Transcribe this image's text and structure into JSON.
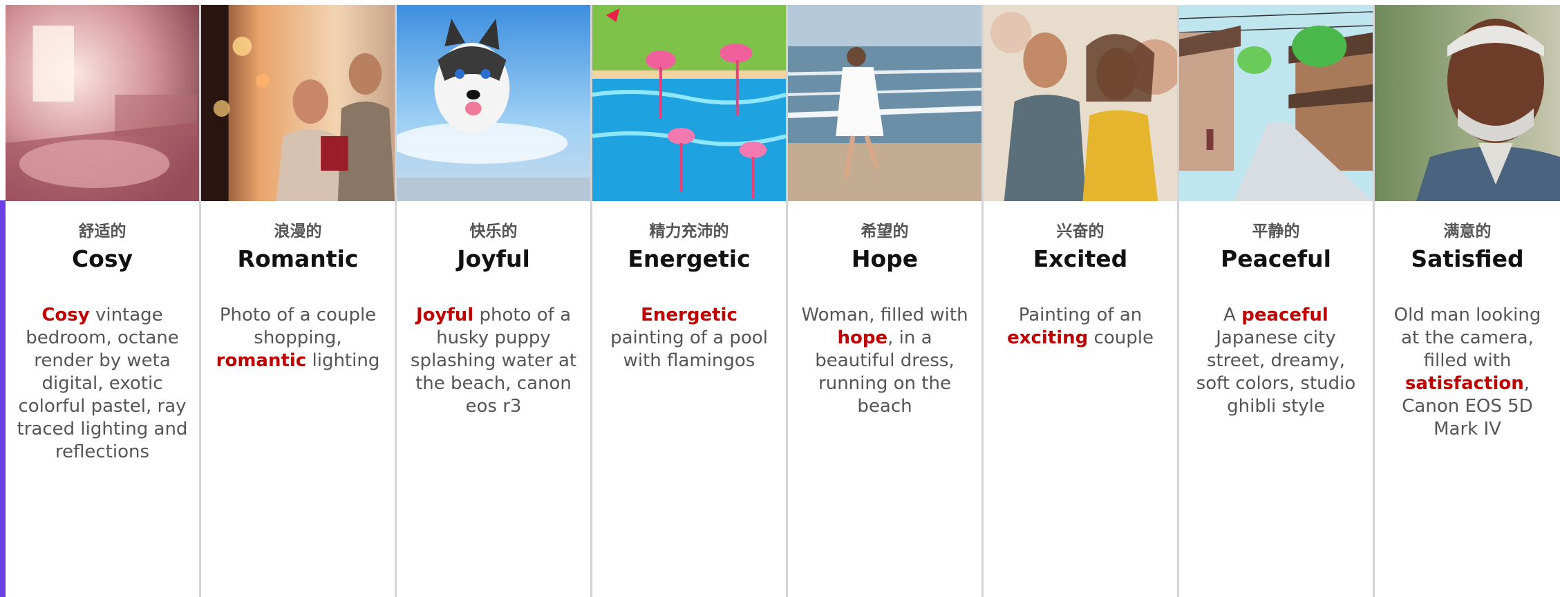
{
  "columns": [
    {
      "zh": "舒适的",
      "en": "Cosy",
      "desc": {
        "pre": "",
        "em": "Cosy",
        "post": " vintage bedroom, octane render by weta digital, exotic colorful pastel, ray traced lighting and reflections"
      },
      "image": "cosy-bedroom-image"
    },
    {
      "zh": "浪漫的",
      "en": "Romantic",
      "desc": {
        "pre": "Photo of a couple shopping, ",
        "em": "romantic",
        "post": " lighting"
      },
      "image": "couple-shopping-image"
    },
    {
      "zh": "快乐的",
      "en": "Joyful",
      "desc": {
        "pre": "",
        "em": "Joyful",
        "post": " photo of a husky puppy splashing water at the beach, canon eos r3"
      },
      "image": "husky-puppy-image"
    },
    {
      "zh": "精力充沛的",
      "en": "Energetic",
      "desc": {
        "pre": "",
        "em": "Energetic",
        "post": " painting of a pool with flamingos"
      },
      "image": "flamingo-pool-image"
    },
    {
      "zh": "希望的",
      "en": "Hope",
      "desc": {
        "pre": "Woman, filled with ",
        "em": "hope",
        "post": ", in a beautiful dress, running on the beach"
      },
      "image": "woman-beach-image"
    },
    {
      "zh": "兴奋的",
      "en": "Excited",
      "desc": {
        "pre": "Painting of an ",
        "em": "exciting",
        "post": " couple"
      },
      "image": "excited-couple-image"
    },
    {
      "zh": "平静的",
      "en": "Peaceful",
      "desc": {
        "pre": "A ",
        "em": "peaceful",
        "post": " Japanese city street, dreamy, soft colors, studio ghibli style"
      },
      "image": "japanese-street-image"
    },
    {
      "zh": "满意的",
      "en": "Satisfied",
      "desc": {
        "pre": "Old man looking at the camera, filled with ",
        "em": "satisfaction",
        "post": ", Canon EOS 5D Mark IV"
      },
      "image": "old-man-image"
    }
  ],
  "colors": {
    "highlight": "#c00000",
    "accent": "#6b3fe6",
    "divider": "#d4d4d4"
  }
}
